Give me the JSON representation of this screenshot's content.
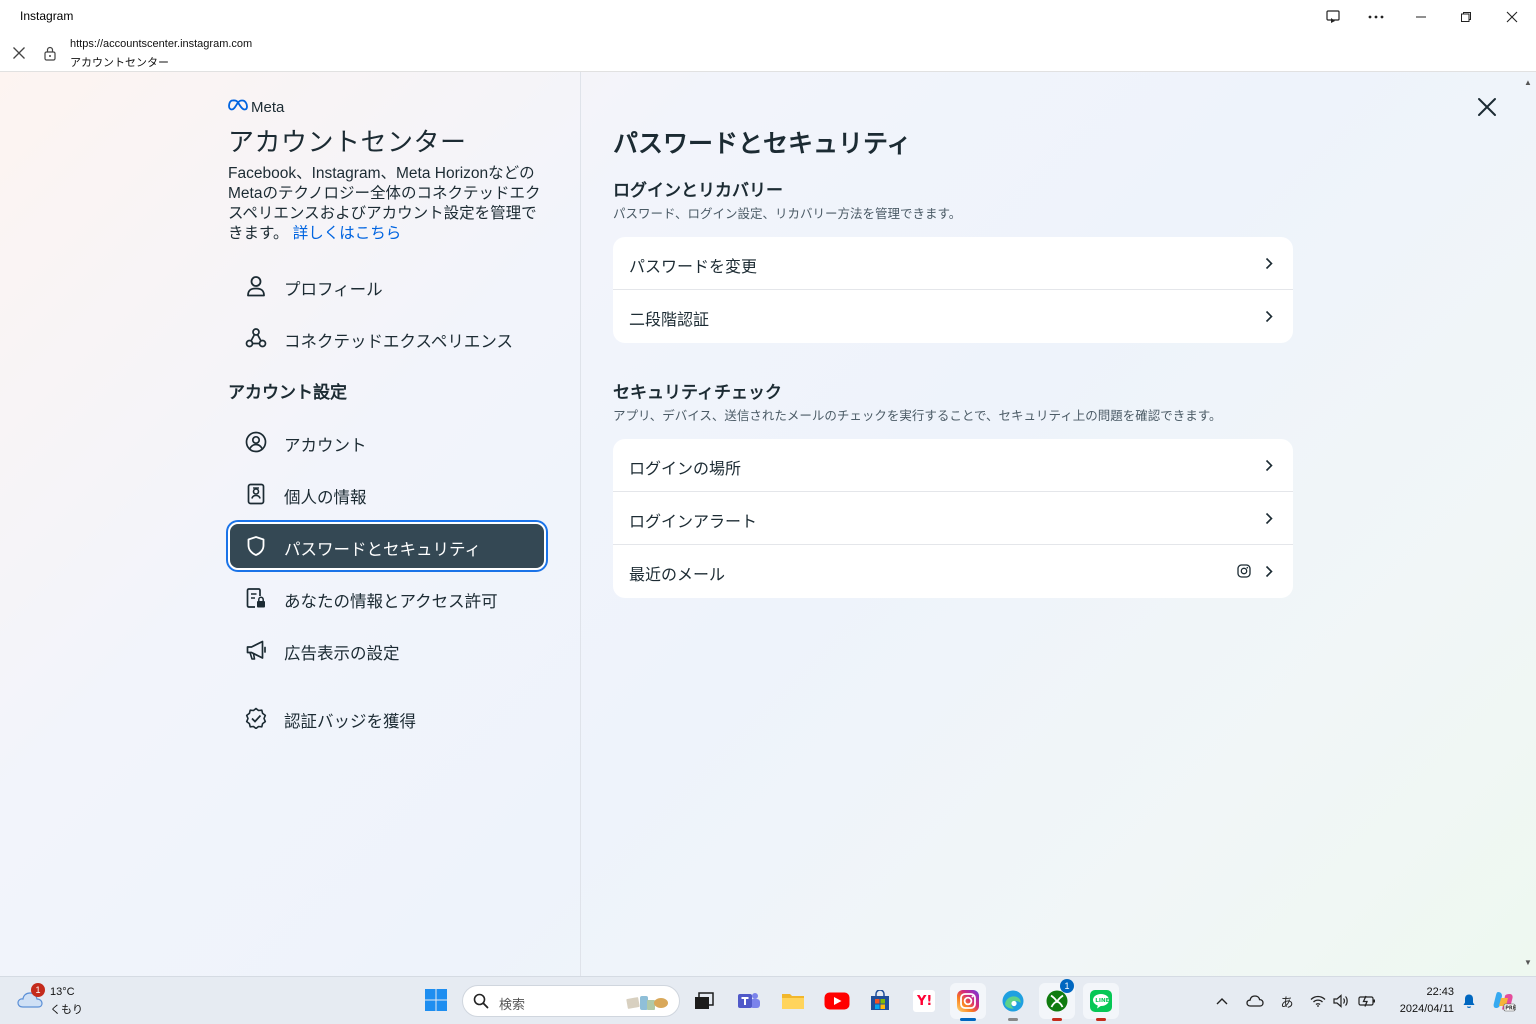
{
  "window": {
    "title": "Instagram"
  },
  "addressbar": {
    "url": "https://accountscenter.instagram.com",
    "page_title": "アカウントセンター"
  },
  "left_nav": {
    "brand": "Meta",
    "title": "アカウントセンター",
    "description": "Facebook、Instagram、Meta Horizonなどの Metaのテクノロジー全体のコネクテッドエクスペリエンスおよびアカウント設定を管理できます。",
    "learn_more": "詳しくはこちら",
    "top_items": [
      {
        "label": "プロフィール",
        "icon": "person-icon"
      },
      {
        "label": "コネクテッドエクスペリエンス",
        "icon": "connected-nodes-icon"
      }
    ],
    "section_heading": "アカウント設定",
    "settings_items": [
      {
        "label": "アカウント",
        "icon": "account-circle-icon"
      },
      {
        "label": "個人の情報",
        "icon": "id-card-icon"
      },
      {
        "label": "パスワードとセキュリティ",
        "icon": "shield-icon",
        "active": true
      },
      {
        "label": "あなたの情報とアクセス許可",
        "icon": "document-lock-icon"
      },
      {
        "label": "広告表示の設定",
        "icon": "megaphone-icon"
      }
    ],
    "verify_item": {
      "label": "認証バッジを獲得",
      "icon": "verified-badge-icon"
    }
  },
  "main": {
    "title": "パスワードとセキュリティ",
    "login_recovery": {
      "title": "ログインとリカバリー",
      "description": "パスワード、ログイン設定、リカバリー方法を管理できます。",
      "rows": [
        "パスワードを変更",
        "二段階認証"
      ]
    },
    "security_check": {
      "title": "セキュリティチェック",
      "description": "アプリ、デバイス、送信されたメールのチェックを実行することで、セキュリティ上の問題を確認できます。",
      "rows": [
        "ログインの場所",
        "ログインアラート",
        "最近のメール"
      ]
    }
  },
  "taskbar": {
    "weather_temp": "13°C",
    "weather_cond": "くもり",
    "weather_badge": "1",
    "search_placeholder": "検索",
    "xbox_badge": "1",
    "ime": "あ",
    "time": "22:43",
    "date": "2024/04/11"
  },
  "colors": {
    "active_nav_bg": "#344854",
    "link": "#0064e0",
    "focus_ring": "#1a73e8"
  }
}
